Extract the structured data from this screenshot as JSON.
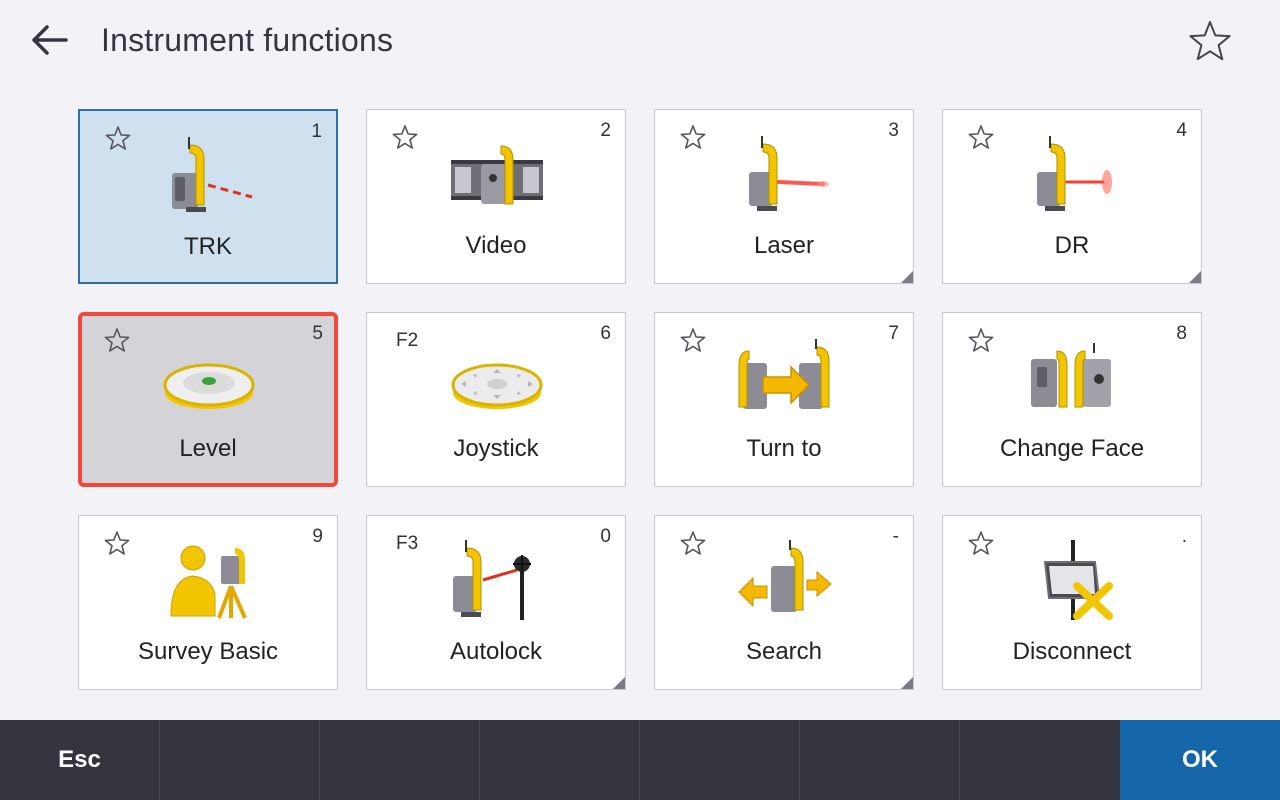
{
  "header": {
    "title": "Instrument functions",
    "back_icon": "arrow-left-icon",
    "favorite_icon": "star-outline-icon"
  },
  "colors": {
    "selected_tile": "#cfe0ee",
    "selected_border": "#2a6fa6",
    "focus_border": "#ef4a3c",
    "focus_tile": "#d4d4d8",
    "instrument_yellow": "#f2c500",
    "footer_bg": "#34343f",
    "ok_button": "#1466a8"
  },
  "tiles": [
    {
      "label": "TRK",
      "hotkey": "1",
      "fkey": "",
      "icon": "instrument-tracking-icon"
    },
    {
      "label": "Video",
      "hotkey": "2",
      "fkey": "",
      "icon": "instrument-video-icon"
    },
    {
      "label": "Laser",
      "hotkey": "3",
      "fkey": "",
      "icon": "instrument-laser-icon"
    },
    {
      "label": "DR",
      "hotkey": "4",
      "fkey": "",
      "icon": "instrument-dr-icon"
    },
    {
      "label": "Level",
      "hotkey": "5",
      "fkey": "",
      "icon": "electronic-level-icon"
    },
    {
      "label": "Joystick",
      "hotkey": "6",
      "fkey": "F2",
      "icon": "joystick-icon"
    },
    {
      "label": "Turn to",
      "hotkey": "7",
      "fkey": "",
      "icon": "instrument-turn-to-icon"
    },
    {
      "label": "Change Face",
      "hotkey": "8",
      "fkey": "",
      "icon": "instrument-change-face-icon"
    },
    {
      "label": "Survey Basic",
      "hotkey": "9",
      "fkey": "",
      "icon": "survey-basic-icon"
    },
    {
      "label": "Autolock",
      "hotkey": "0",
      "fkey": "F3",
      "icon": "autolock-prism-icon"
    },
    {
      "label": "Search",
      "hotkey": "-",
      "fkey": "",
      "icon": "instrument-search-icon"
    },
    {
      "label": "Disconnect",
      "hotkey": ".",
      "fkey": "",
      "icon": "disconnect-icon"
    }
  ],
  "footer": {
    "esc_label": "Esc",
    "ok_label": "OK"
  }
}
